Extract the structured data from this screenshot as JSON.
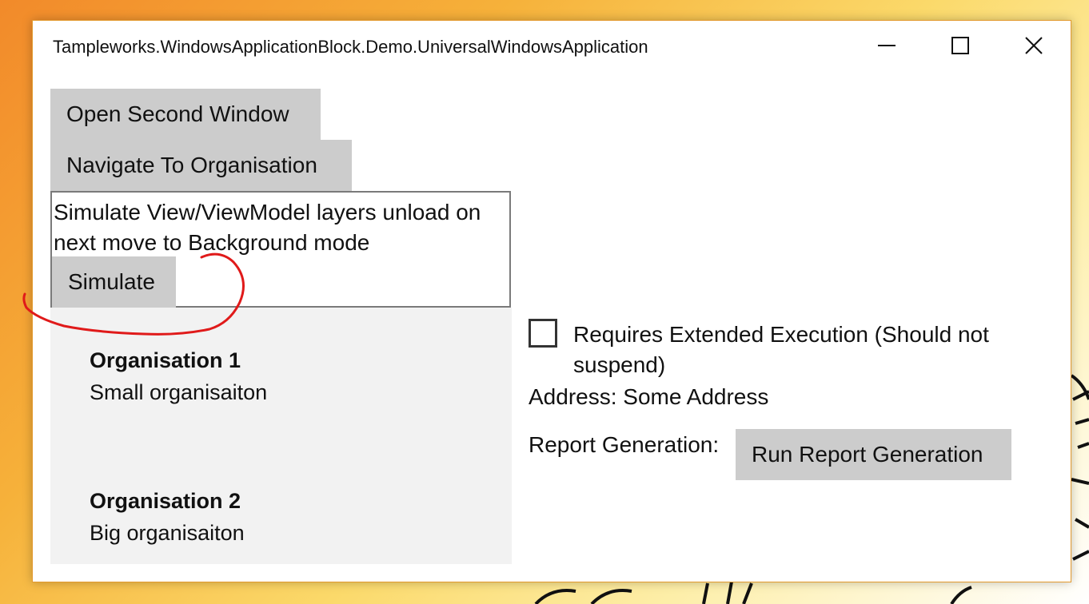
{
  "window": {
    "title": "Tampleworks.WindowsApplicationBlock.Demo.UniversalWindowsApplication",
    "caption_buttons": {
      "minimize_icon": "minimize-icon",
      "maximize_icon": "maximize-icon",
      "close_icon": "close-icon"
    }
  },
  "toolbar": {
    "open_second_window_label": "Open Second Window",
    "navigate_to_organisation_label": "Navigate To Organisation"
  },
  "simulate_panel": {
    "description": "Simulate View/ViewModel layers unload on next move to Background mode",
    "button_label": "Simulate"
  },
  "organisations": [
    {
      "name": "Organisation 1",
      "description": "Small organisaiton"
    },
    {
      "name": "Organisation 2",
      "description": "Big organisaiton"
    }
  ],
  "details": {
    "extended_execution_label": "Requires Extended Execution (Should not suspend)",
    "extended_execution_checked": false,
    "address_label": "Address:",
    "address_value": "Some Address",
    "report_generation_label": "Report Generation:",
    "run_report_button_label": "Run Report Generation"
  },
  "colors": {
    "button_gray": "#cccccc",
    "list_background": "#f2f2f2",
    "annotation_red": "#e01a1a",
    "window_border": "#e39a2e"
  }
}
